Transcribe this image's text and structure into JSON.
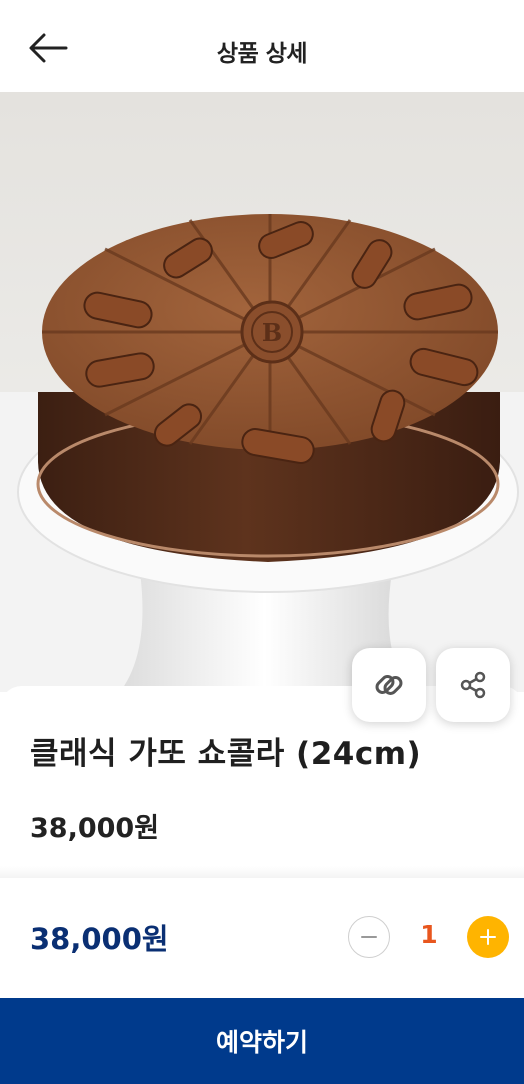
{
  "header": {
    "title": "상품 상세",
    "back_icon": "arrow-left-icon"
  },
  "product": {
    "image_alt": "chocolate-cake-photo",
    "name": "클래식 가또 쇼콜라 (24cm)",
    "price": "38,000원",
    "like_icon": "link-icon",
    "share_icon": "share-icon"
  },
  "order": {
    "total_price": "38,000원",
    "quantity": "1",
    "minus_icon": "minus-icon",
    "plus_icon": "plus-icon",
    "reserve_label": "예약하기"
  },
  "colors": {
    "primary": "#003a8c",
    "price_text": "#0a2f73",
    "quantity_text": "#e8561e",
    "plus_button": "#ffb400"
  }
}
